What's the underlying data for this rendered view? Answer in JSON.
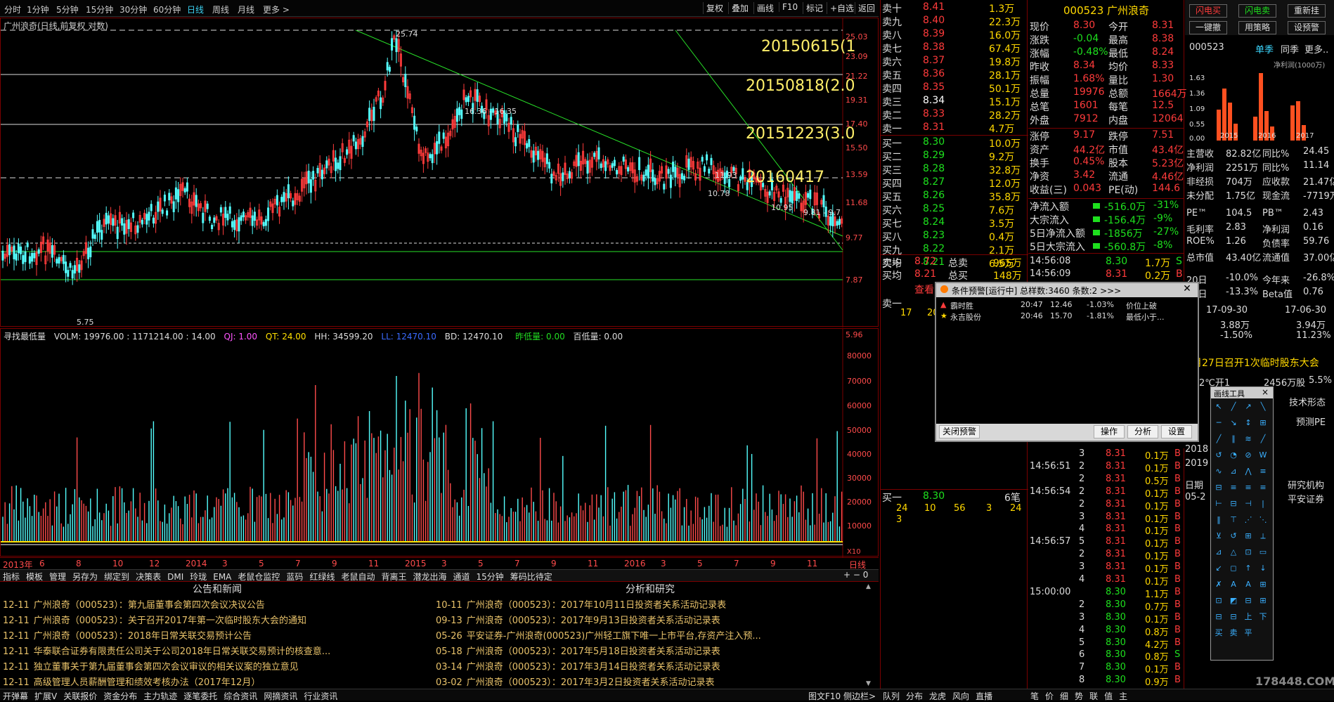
{
  "periods": [
    "分时",
    "1分钟",
    "5分钟",
    "15分钟",
    "30分钟",
    "60分钟",
    "日线",
    "周线",
    "月线",
    "更多 >"
  ],
  "active_period": "日线",
  "top_buttons": [
    "复权",
    "叠加",
    "画线",
    "F10",
    "标记",
    "+自选",
    "返回"
  ],
  "chart": {
    "title": "广州浪奇(日线,前复权 对数)",
    "ylabels": [
      "25.03",
      "23.09",
      "21.22",
      "19.31",
      "17.40",
      "15.50",
      "13.59",
      "11.68",
      "9.77",
      "7.87",
      "5.96"
    ],
    "annotations": [
      "20150615(1",
      "20150818(2.0",
      "20151223(3.0",
      "20160417"
    ],
    "price_labels": [
      "25.74",
      "16.36 - 16.35",
      "11.93",
      "10.78",
      "10.95",
      "9.81 - 9.7",
      "5.75"
    ],
    "xaxis": [
      "2013年",
      "6",
      "8",
      "10",
      "12",
      "2014",
      "3",
      "5",
      "7",
      "9",
      "11",
      "2015",
      "3",
      "5",
      "7",
      "9",
      "11",
      "2016",
      "3",
      "5",
      "7",
      "9",
      "11",
      "日线"
    ]
  },
  "indicator": {
    "name": "寻找最低量",
    "vol": "VOLM: 19976.00 : 1171214.00 : 14.00",
    "qj": "QJ: 1.00",
    "qt": "QT: 24.00",
    "hh": "HH: 34599.20",
    "ll": "LL: 12470.10",
    "bd": "BD: 12470.10",
    "zdl": "昨低量: 0.00",
    "bdl": "百低量: 0.00",
    "ylabels": [
      "80000",
      "70000",
      "60000",
      "50000",
      "40000",
      "30000",
      "20000",
      "10000"
    ],
    "x10": "X10"
  },
  "bottom_tabs": [
    "指标",
    "模板",
    "管理",
    "另存为",
    "绑定到",
    "决策表",
    "DMI",
    "玲珑",
    "EMA",
    "老鼠仓监控",
    "蓝码",
    "红绿线",
    "老鼠自动",
    "背离王",
    "潜龙出海",
    "通道",
    "15分钟",
    "筹码比待定"
  ],
  "news": {
    "left_title": "公告和新闻",
    "right_title": "分析和研究",
    "left": [
      {
        "d": "12-11",
        "t": "广州浪奇（000523）：第九届董事会第四次会议决议公告"
      },
      {
        "d": "12-11",
        "t": "广州浪奇（000523）：关于召开2017年第一次临时股东大会的通知"
      },
      {
        "d": "12-11",
        "t": "广州浪奇（000523）：2018年日常关联交易预计公告"
      },
      {
        "d": "12-11",
        "t": "华泰联合证券有限责任公司关于公司2018年日常关联交易预计的核查意..."
      },
      {
        "d": "12-11",
        "t": "独立董事关于第九届董事会第四次会议审议的相关议案的独立意见"
      },
      {
        "d": "12-11",
        "t": "高级管理人员薪酬管理和绩效考核办法（2017年12月）"
      }
    ],
    "right": [
      {
        "d": "10-11",
        "t": "广州浪奇（000523）：2017年10月11日投资者关系活动记录表"
      },
      {
        "d": "09-13",
        "t": "广州浪奇（000523）：2017年9月13日投资者关系活动记录表"
      },
      {
        "d": "05-26",
        "t": "平安证券-广州浪奇(000523)广州轻工旗下唯一上市平台,存资产注入预..."
      },
      {
        "d": "05-18",
        "t": "广州浪奇（000523）：2017年5月18日投资者关系活动记录表"
      },
      {
        "d": "03-14",
        "t": "广州浪奇（000523）：2017年3月14日投资者关系活动记录表"
      },
      {
        "d": "03-02",
        "t": "广州浪奇（000523）：2017年3月2日投资者关系活动记录表"
      }
    ]
  },
  "status_tabs": [
    "开弹幕",
    "扩展V",
    "关联报价",
    "资金分布",
    "主力轨迹",
    "逐笔委托",
    "综合资讯",
    "网摘资讯",
    "行业资讯"
  ],
  "status_right": [
    "图文F10",
    "侧边栏>"
  ],
  "quote": {
    "asks": [
      {
        "l": "卖十",
        "p": "8.41",
        "v": "1.3万"
      },
      {
        "l": "卖九",
        "p": "8.40",
        "v": "22.3万"
      },
      {
        "l": "卖八",
        "p": "8.39",
        "v": "16.0万"
      },
      {
        "l": "卖七",
        "p": "8.38",
        "v": "67.4万"
      },
      {
        "l": "卖六",
        "p": "8.37",
        "v": "19.8万"
      },
      {
        "l": "卖五",
        "p": "8.36",
        "v": "28.1万"
      },
      {
        "l": "卖四",
        "p": "8.35",
        "v": "50.1万"
      },
      {
        "l": "卖三",
        "p": "8.34",
        "v": "15.1万"
      },
      {
        "l": "卖二",
        "p": "8.33",
        "v": "28.2万"
      },
      {
        "l": "卖一",
        "p": "8.31",
        "v": "4.7万"
      }
    ],
    "bids": [
      {
        "l": "买一",
        "p": "8.30",
        "v": "10.0万"
      },
      {
        "l": "买二",
        "p": "8.29",
        "v": "9.2万"
      },
      {
        "l": "买三",
        "p": "8.28",
        "v": "32.8万"
      },
      {
        "l": "买四",
        "p": "8.27",
        "v": "12.0万"
      },
      {
        "l": "买五",
        "p": "8.26",
        "v": "35.8万"
      },
      {
        "l": "买六",
        "p": "8.25",
        "v": "7.6万"
      },
      {
        "l": "买七",
        "p": "8.24",
        "v": "3.5万"
      },
      {
        "l": "买八",
        "p": "8.23",
        "v": "0.4万"
      },
      {
        "l": "买九",
        "p": "8.22",
        "v": "2.1万"
      },
      {
        "l": "买十",
        "p": "8.21",
        "v": "6.5万"
      }
    ],
    "avg_sell": {
      "l": "卖均",
      "p": "8.72",
      "l2": "总卖",
      "v": "965万"
    },
    "avg_buy": {
      "l": "买均",
      "p": "8.21",
      "l2": "总买",
      "v": "148万"
    },
    "queue_label": "查看",
    "sell1_label": "卖一",
    "sell1_a": "17",
    "sell1_b": "20",
    "buy1_label": "买一",
    "buy1_price": "8.30",
    "buy1_count": "6笔",
    "buy1_queue": [
      "24",
      "10",
      "56",
      "3",
      "24",
      "3"
    ]
  },
  "stock": {
    "code_name": "000523 广州浪奇",
    "rows": [
      [
        "现价",
        "8.30",
        "今开",
        "8.31"
      ],
      [
        "涨跌",
        "-0.04",
        "最高",
        "8.38"
      ],
      [
        "涨幅",
        "-0.48%",
        "最低",
        "8.24"
      ],
      [
        "昨收",
        "8.34",
        "均价",
        "8.33"
      ],
      [
        "振幅",
        "1.68%",
        "量比",
        "1.30"
      ],
      [
        "总量",
        "19976",
        "总额",
        "1664万"
      ],
      [
        "总笔",
        "1601",
        "每笔",
        "12.5"
      ],
      [
        "外盘",
        "7912",
        "内盘",
        "12064"
      ]
    ],
    "rows2": [
      [
        "涨停",
        "9.17",
        "跌停",
        "7.51"
      ],
      [
        "资产",
        "44.2亿",
        "市值",
        "43.4亿"
      ],
      [
        "换手",
        "0.45%",
        "股本",
        "5.23亿"
      ],
      [
        "净资",
        "3.42",
        "流通",
        "4.46亿"
      ],
      [
        "收益(三)",
        "0.043",
        "PE(动)",
        "144.6"
      ]
    ],
    "flows": [
      [
        "净流入额",
        "-516.0万",
        "-31%"
      ],
      [
        "大宗流入",
        "-156.4万",
        "-9%"
      ],
      [
        "5日净流入额",
        "-1856万",
        "-27%"
      ],
      [
        "5日大宗流入",
        "-560.8万",
        "-8%"
      ]
    ],
    "time1": "14:56:08",
    "p1": "8.30",
    "v1": "1.7万",
    "s1": "S",
    "time2": "14:56:09",
    "p2": "8.31",
    "v2": "0.2万",
    "s2": "B"
  },
  "ticks": [
    {
      "t": "",
      "n": "3",
      "p": "8.31",
      "v": "0.1万",
      "s": "B"
    },
    {
      "t": "14:56:51",
      "n": "2",
      "p": "8.31",
      "v": "0.1万",
      "s": "B"
    },
    {
      "t": "",
      "n": "2",
      "p": "8.31",
      "v": "0.5万",
      "s": "B"
    },
    {
      "t": "14:56:54",
      "n": "2",
      "p": "8.31",
      "v": "0.1万",
      "s": "B"
    },
    {
      "t": "",
      "n": "2",
      "p": "8.31",
      "v": "0.1万",
      "s": "B"
    },
    {
      "t": "",
      "n": "3",
      "p": "8.31",
      "v": "0.1万",
      "s": "B"
    },
    {
      "t": "",
      "n": "4",
      "p": "8.31",
      "v": "0.1万",
      "s": "B"
    },
    {
      "t": "14:56:57",
      "n": "5",
      "p": "8.31",
      "v": "0.1万",
      "s": "B"
    },
    {
      "t": "",
      "n": "2",
      "p": "8.31",
      "v": "0.1万",
      "s": "B"
    },
    {
      "t": "",
      "n": "3",
      "p": "8.31",
      "v": "0.1万",
      "s": "B"
    },
    {
      "t": "",
      "n": "4",
      "p": "8.31",
      "v": "0.1万",
      "s": "B"
    },
    {
      "t": "15:00:00",
      "n": "",
      "p": "8.30",
      "v": "1.1万",
      "s": "B"
    },
    {
      "t": "",
      "n": "2",
      "p": "8.30",
      "v": "0.7万",
      "s": "B"
    },
    {
      "t": "",
      "n": "3",
      "p": "8.30",
      "v": "0.1万",
      "s": "B"
    },
    {
      "t": "",
      "n": "4",
      "p": "8.30",
      "v": "0.8万",
      "s": "B"
    },
    {
      "t": "",
      "n": "5",
      "p": "8.30",
      "v": "4.2万",
      "s": "B"
    },
    {
      "t": "",
      "n": "6",
      "p": "8.30",
      "v": "0.8万",
      "s": "S"
    },
    {
      "t": "",
      "n": "7",
      "p": "8.30",
      "v": "0.1万",
      "s": "B"
    },
    {
      "t": "",
      "n": "8",
      "p": "8.30",
      "v": "0.9万",
      "s": "B"
    }
  ],
  "mid_tabs": [
    "队列",
    "分布",
    "龙虎",
    "风向",
    "直播"
  ],
  "right_tabs": [
    "笔",
    "价",
    "细",
    "势",
    "联",
    "值",
    "主"
  ],
  "dialog": {
    "title": "条件预警[运行中] 总样数:3460 条数:2 >>>",
    "rows": [
      {
        "name": "霸时胜",
        "time": "20:47",
        "price": "12.46",
        "pct": "-1.03%",
        "desc": "价位上破"
      },
      {
        "name": "永吉股份",
        "time": "20:46",
        "price": "15.70",
        "pct": "-1.81%",
        "desc": "最低小于..."
      }
    ],
    "btn_close": "关闭预警",
    "btn_op": "操作",
    "btn_an": "分析",
    "btn_set": "设置"
  },
  "far": {
    "buttons_top": [
      "闪电买",
      "闪电卖",
      "重新挂",
      "一键撤",
      "用策略",
      "设预警"
    ],
    "code": "000523",
    "tabs": [
      "单季",
      "同季",
      "更多.."
    ],
    "net_label": "净利润(1000万)",
    "ylabels": [
      "1.63",
      "1.36",
      "1.09",
      "0.55",
      "0.00"
    ],
    "years": [
      "2015",
      "2016",
      "2017"
    ],
    "fin": [
      [
        "主营收",
        "82.82亿",
        "同比%",
        "24.45"
      ],
      [
        "净利润",
        "2251万",
        "同比%",
        "11.14"
      ],
      [
        "非经损",
        "704万",
        "应收款",
        "21.47亿"
      ],
      [
        "未分配",
        "1.75亿",
        "现金流",
        "-7719万"
      ]
    ],
    "fin2": [
      [
        "PE™",
        "104.5",
        "PB™",
        "2.43"
      ],
      [
        "毛利率",
        "2.83",
        "净利润",
        "0.16"
      ],
      [
        "ROE%",
        "1.26",
        "负债率",
        "59.76"
      ],
      [
        "总市值",
        "43.40亿",
        "流通值",
        "37.00亿"
      ]
    ],
    "perf": [
      [
        "20日",
        "-10.0%",
        "今年来",
        "-26.8%"
      ],
      [
        "60日",
        "-13.3%",
        "Beta值",
        "0.76"
      ]
    ],
    "dates": [
      "17-09-30",
      "17-06-30"
    ],
    "nums": [
      "3.88万",
      "3.94万"
    ],
    "pcts": [
      "-1.50%",
      "11.23%"
    ],
    "notice": "月27日召开1次临时股东大会",
    "frag": [
      "2℃开1",
      "2456万股",
      "5.5%"
    ],
    "side_labels": [
      "技术形态",
      "预测PE",
      "研究机构",
      "平安证券",
      "日期",
      "05-2",
      "2018",
      "2019"
    ],
    "watermark": "178448.COM"
  },
  "toolbox": {
    "title": "画线工具",
    "close": "×"
  }
}
